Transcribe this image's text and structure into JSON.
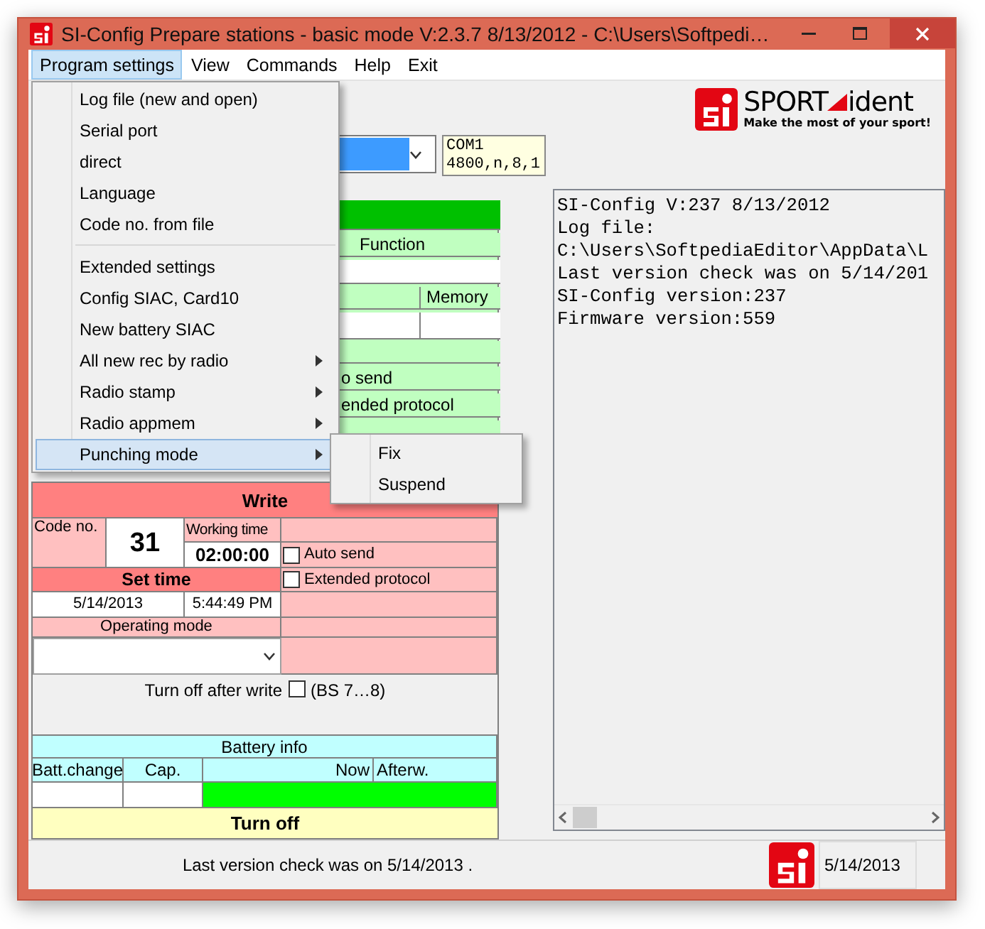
{
  "window": {
    "title": "SI-Config Prepare stations - basic mode V:2.3.7 8/13/2012 - C:\\Users\\Softpedi…"
  },
  "menu_bar": [
    {
      "label": "Program settings",
      "selected": true
    },
    {
      "label": "View",
      "selected": false
    },
    {
      "label": "Commands",
      "selected": false
    },
    {
      "label": "Help",
      "selected": false
    },
    {
      "label": "Exit",
      "selected": false
    }
  ],
  "open_menu": [
    {
      "kind": "item",
      "label": "Log file  (new and open)",
      "submenu": false,
      "selected": false
    },
    {
      "kind": "item",
      "label": "Serial port",
      "submenu": false,
      "selected": false
    },
    {
      "kind": "item",
      "label": "direct",
      "submenu": false,
      "selected": false
    },
    {
      "kind": "item",
      "label": "Language",
      "submenu": false,
      "selected": false
    },
    {
      "kind": "item",
      "label": "Code no. from file",
      "submenu": false,
      "selected": false
    },
    {
      "kind": "separator"
    },
    {
      "kind": "item",
      "label": "Extended settings",
      "submenu": false,
      "selected": false
    },
    {
      "kind": "item",
      "label": "Config SIAC, Card10",
      "submenu": false,
      "selected": false
    },
    {
      "kind": "item",
      "label": "New battery SIAC",
      "submenu": false,
      "selected": false
    },
    {
      "kind": "item",
      "label": "All new rec by radio",
      "submenu": true,
      "selected": false
    },
    {
      "kind": "item",
      "label": "Radio stamp",
      "submenu": true,
      "selected": false
    },
    {
      "kind": "item",
      "label": "Radio appmem",
      "submenu": true,
      "selected": false
    },
    {
      "kind": "item",
      "label": "Punching mode",
      "submenu": true,
      "selected": true
    }
  ],
  "submenu": [
    {
      "label": "Fix",
      "selected": false
    },
    {
      "label": "Suspend",
      "selected": false
    }
  ],
  "logo": {
    "brand": "SPORT",
    "brand_suffix": "ident",
    "tagline": "Make the most of your sport!"
  },
  "port": {
    "lines": [
      "COM1",
      "4800,n,8,1"
    ]
  },
  "read_panel": {
    "function_label": "Function",
    "memory_label": "Memory",
    "options": [
      "o send",
      "ended protocol"
    ]
  },
  "write_panel": {
    "button": "Write",
    "code_label": "Code no.",
    "code_value": "31",
    "working_time_label": "Working time",
    "working_time_value": "02:00:00",
    "set_time_button": "Set time",
    "date": "5/14/2013",
    "time": "5:44:49 PM",
    "operating_mode_label": "Operating mode",
    "options": [
      {
        "label": "Auto send",
        "checked": false
      },
      {
        "label": "Extended protocol",
        "checked": false
      }
    ],
    "turn_off_after_write": {
      "label": "Turn off after write",
      "checked": false,
      "note": "(BS 7…8)"
    }
  },
  "battery": {
    "title": "Battery info",
    "columns": [
      "Batt.change",
      "Cap.",
      "Now",
      "Afterw."
    ]
  },
  "turn_off_button": "Turn off",
  "log": [
    "SI-Config V:237 8/13/2012",
    "Log file:",
    "C:\\Users\\SoftpediaEditor\\AppData\\L",
    "Last version check was on 5/14/201",
    "SI-Config version:237",
    "Firmware version:559"
  ],
  "status_bar": {
    "message": "Last version check was on 5/14/2013 .",
    "date": "5/14/2013"
  }
}
